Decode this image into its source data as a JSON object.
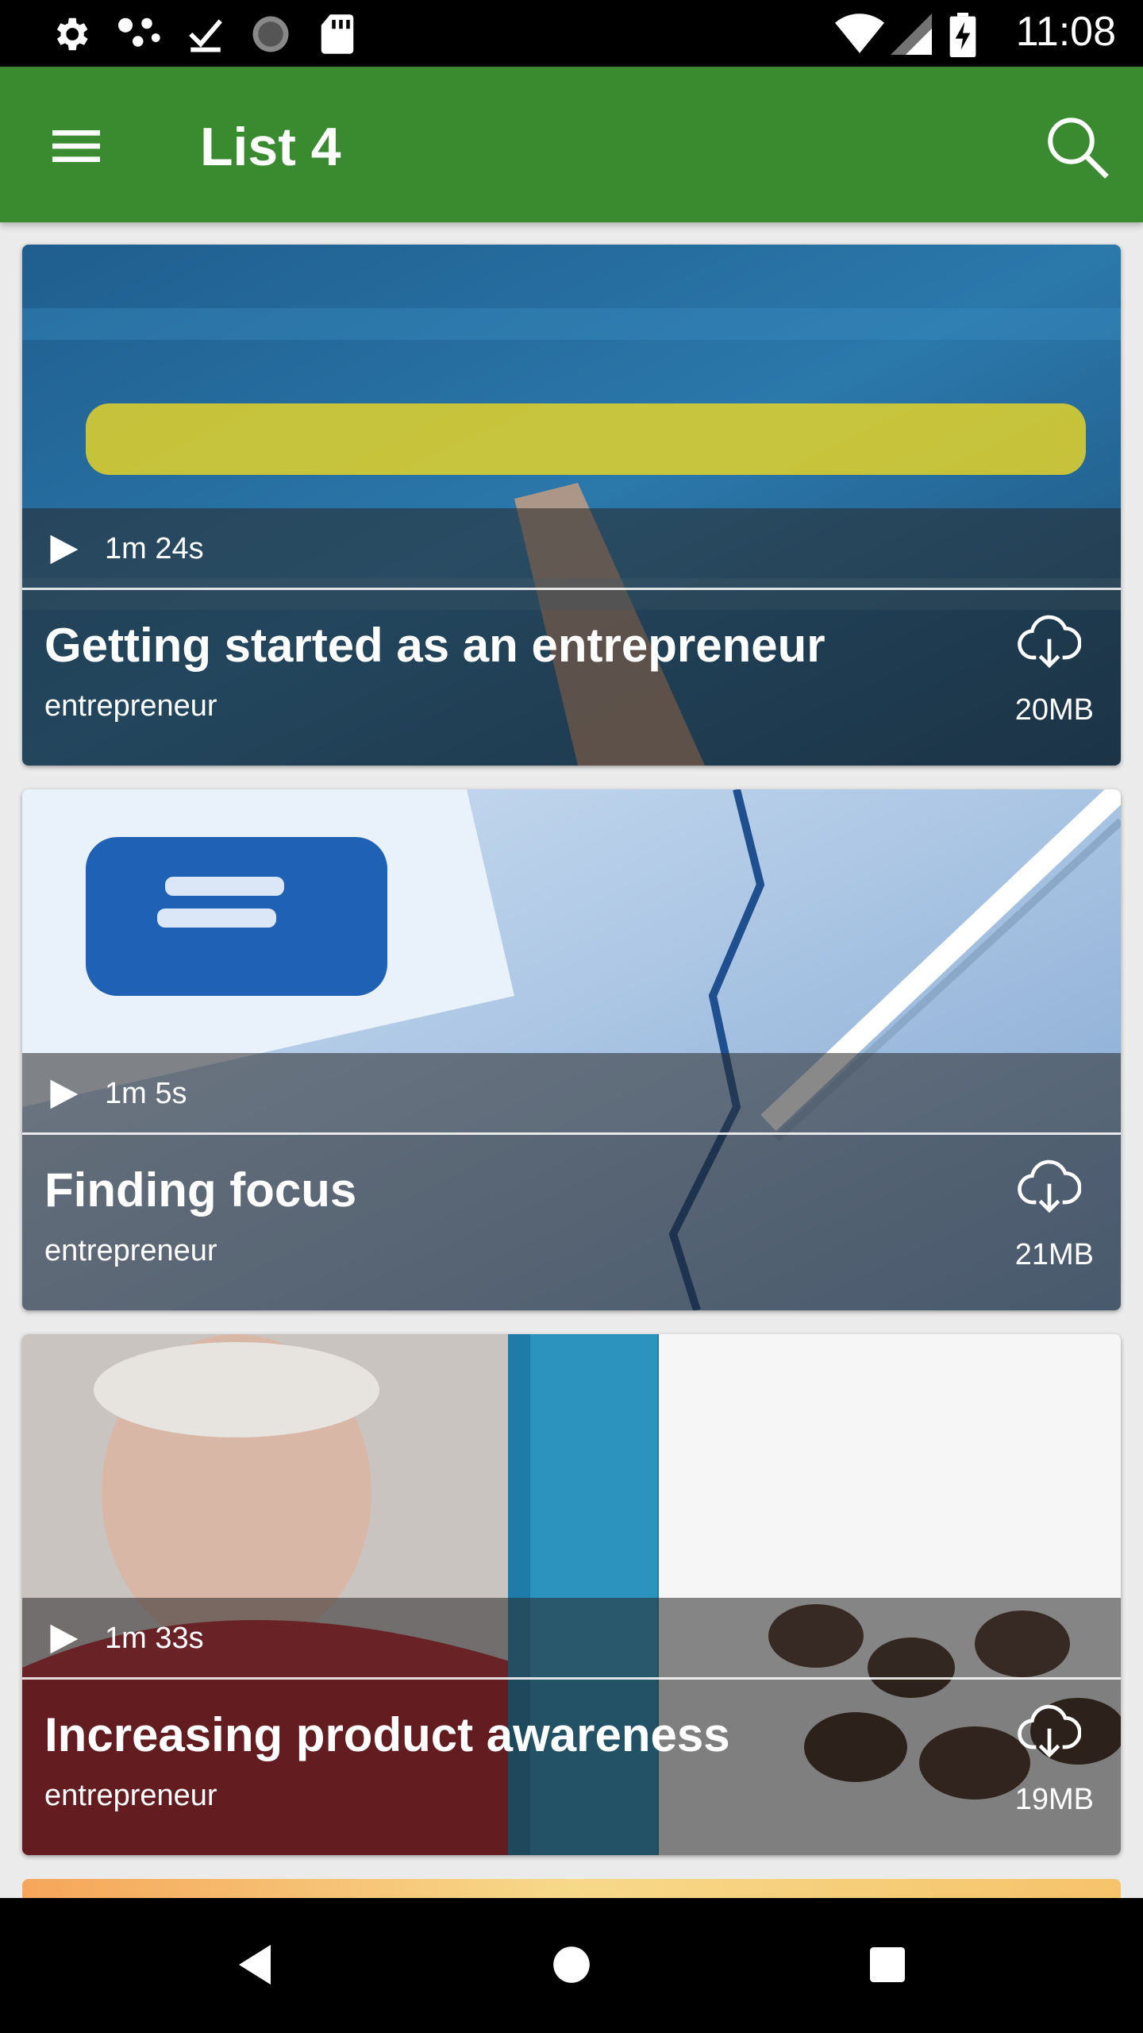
{
  "status_bar": {
    "time": "11:08",
    "icons": [
      "settings-icon",
      "dots-icon",
      "check-download-icon",
      "spinner-icon",
      "sd-card-icon",
      "wifi-icon",
      "signal-icon",
      "battery-charging-icon"
    ]
  },
  "app_bar": {
    "title": "List 4",
    "menu_icon": "hamburger-menu-icon",
    "search_icon": "search-icon",
    "color": "#3a8a2f"
  },
  "cards": [
    {
      "duration": "1m 24s",
      "title": "Getting started as an entrepreneur",
      "category": "entrepreneur",
      "size": "20MB"
    },
    {
      "duration": "1m 5s",
      "title": "Finding focus",
      "category": "entrepreneur",
      "size": "21MB"
    },
    {
      "duration": "1m 33s",
      "title": "Increasing product awareness",
      "category": "entrepreneur",
      "size": "19MB"
    }
  ],
  "nav_bar": {
    "icons": [
      "back-icon",
      "home-icon",
      "recents-icon"
    ]
  }
}
